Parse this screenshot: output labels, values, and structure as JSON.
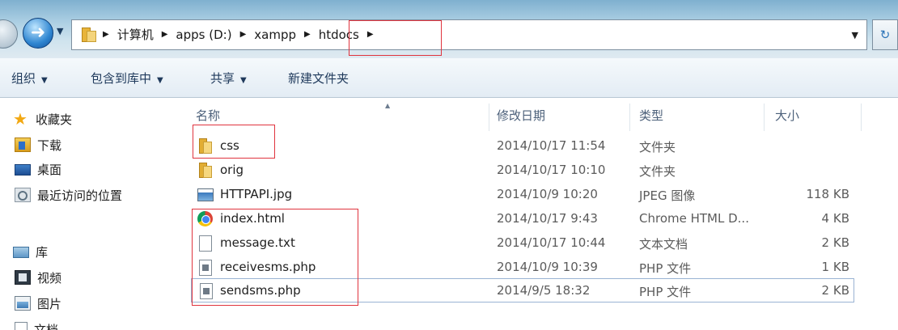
{
  "address_bar": {
    "path": [
      {
        "label": "计算机"
      },
      {
        "label": "apps (D:)"
      },
      {
        "label": "xampp"
      },
      {
        "label": "htdocs"
      }
    ]
  },
  "toolbar": {
    "organize_label": "组织",
    "include_library_label": "包含到库中",
    "share_label": "共享",
    "new_folder_label": "新建文件夹"
  },
  "nav": {
    "favorites_label": "收藏夹",
    "favorites": [
      {
        "label": "下载",
        "icon": "download-folder-icon"
      },
      {
        "label": "桌面",
        "icon": "desktop-icon"
      },
      {
        "label": "最近访问的位置",
        "icon": "recent-places-icon"
      }
    ],
    "libraries_label": "库",
    "libraries": [
      {
        "label": "视频",
        "icon": "video-icon"
      },
      {
        "label": "图片",
        "icon": "pictures-icon"
      },
      {
        "label": "文档",
        "icon": "documents-icon"
      }
    ]
  },
  "columns": {
    "name": "名称",
    "date": "修改日期",
    "type": "类型",
    "size": "大小"
  },
  "files": [
    {
      "name": "css",
      "date": "2014/10/17 11:54",
      "type": "文件夹",
      "size": "",
      "icon": "folder-icon"
    },
    {
      "name": "orig",
      "date": "2014/10/17 10:10",
      "type": "文件夹",
      "size": "",
      "icon": "folder-icon"
    },
    {
      "name": "HTTPAPI.jpg",
      "date": "2014/10/9 10:20",
      "type": "JPEG 图像",
      "size": "118 KB",
      "icon": "image-file-icon"
    },
    {
      "name": "index.html",
      "date": "2014/10/17 9:43",
      "type": "Chrome HTML D...",
      "size": "4 KB",
      "icon": "chrome-html-icon"
    },
    {
      "name": "message.txt",
      "date": "2014/10/17 10:44",
      "type": "文本文档",
      "size": "2 KB",
      "icon": "text-file-icon"
    },
    {
      "name": "receivesms.php",
      "date": "2014/10/9 10:39",
      "type": "PHP 文件",
      "size": "1 KB",
      "icon": "php-file-icon"
    },
    {
      "name": "sendsms.php",
      "date": "2014/9/5 18:32",
      "type": "PHP 文件",
      "size": "2 KB",
      "icon": "php-file-icon"
    }
  ],
  "colors": {
    "annotation_red": "#e0343e",
    "toolbar_text": "#1e395b",
    "header_text": "#4c607a"
  }
}
